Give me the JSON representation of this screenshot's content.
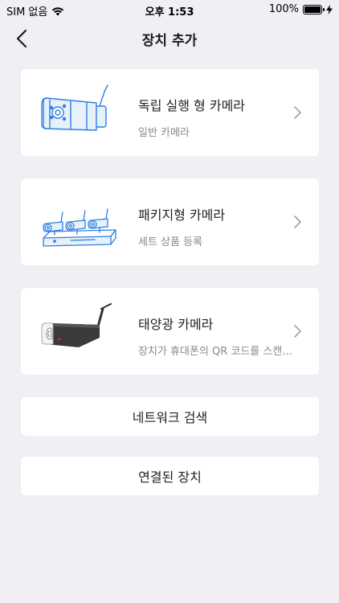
{
  "status_bar": {
    "carrier": "SIM 없음",
    "time": "오후 1:53",
    "battery": "100%",
    "battery_level": 1.0
  },
  "nav": {
    "title": "장치 추가",
    "back_icon": "chevron-left-icon"
  },
  "devices": [
    {
      "title": "독립 실행 형 카메라",
      "subtitle": "일반 카메라",
      "icon": "bullet-camera-icon"
    },
    {
      "title": "패키지형 카메라",
      "subtitle": "세트 상품 등록",
      "icon": "camera-kit-nvr-icon"
    },
    {
      "title": "태양광 카메라",
      "subtitle": "장치가 휴대폰의 QR 코드를 스캔합니다",
      "icon": "solar-camera-icon"
    }
  ],
  "buttons": {
    "network_search": "네트워크 검색",
    "connected_devices": "연결된 장치"
  },
  "colors": {
    "background": "#efeff4",
    "card": "#ffffff",
    "illustration_blue": "#2f7fe0",
    "illustration_fill": "#e8f0fb"
  }
}
